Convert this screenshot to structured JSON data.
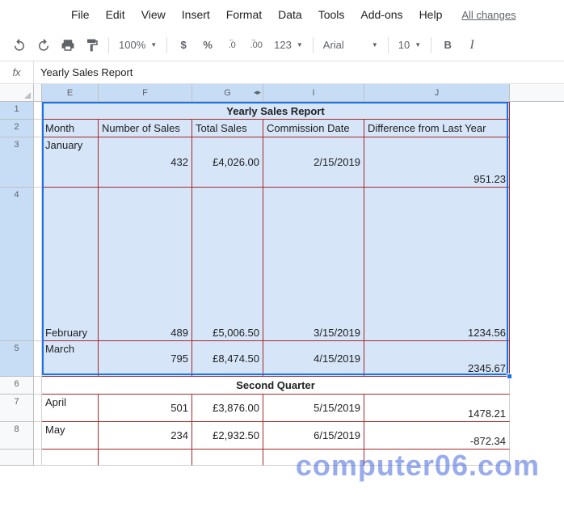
{
  "menu": {
    "file": "File",
    "edit": "Edit",
    "view": "View",
    "insert": "Insert",
    "format": "Format",
    "data": "Data",
    "tools": "Tools",
    "addons": "Add-ons",
    "help": "Help",
    "changes": "All changes"
  },
  "toolbar": {
    "zoom": "100%",
    "currency": "$",
    "percent": "%",
    "dec0": ".0",
    "dec00": ".00",
    "more_fmt": "123",
    "font": "Arial",
    "size": "10",
    "bold": "B",
    "italic": "I"
  },
  "formula": {
    "fx": "fx",
    "value": "Yearly Sales Report"
  },
  "cols": {
    "blank": "",
    "E": "E",
    "F": "F",
    "G": "G",
    "I": "I",
    "J": "J",
    "w_blank": 10,
    "w_E": 70,
    "w_F": 116,
    "w_G": 88,
    "w_I": 125,
    "w_J": 180
  },
  "rows": {
    "h1": 22,
    "h2": 22,
    "h3": 62,
    "h4": 190,
    "h5": 44,
    "h6": 22,
    "h7": 34,
    "h8": 34,
    "h9": 20,
    "r1": "1",
    "r2": "2",
    "r3": "3",
    "r4": "4",
    "r5": "5",
    "r6": "6",
    "r7": "7",
    "r8": "8",
    "r9": ""
  },
  "data": {
    "title": "Yearly Sales Report",
    "h_month": "Month",
    "h_num": "Number of Sales",
    "h_total": "Total Sales",
    "h_comm": "Commission Date",
    "h_diff": "Difference from Last Year",
    "r3": {
      "m": "January",
      "n": "432",
      "t": "£4,026.00",
      "c": "2/15/2019",
      "d": "951.23"
    },
    "r4": {
      "m": "February",
      "n": "489",
      "t": "£5,006.50",
      "c": "3/15/2019",
      "d": "1234.56"
    },
    "r5": {
      "m": "March",
      "n": "795",
      "t": "£8,474.50",
      "c": "4/15/2019",
      "d": "2345.67"
    },
    "q2": "Second Quarter",
    "r7": {
      "m": "April",
      "n": "501",
      "t": "£3,876.00",
      "c": "5/15/2019",
      "d": "1478.21"
    },
    "r8": {
      "m": "May",
      "n": "234",
      "t": "£2,932.50",
      "c": "6/15/2019",
      "d": "-872.34"
    }
  },
  "watermark": "computer06.com"
}
